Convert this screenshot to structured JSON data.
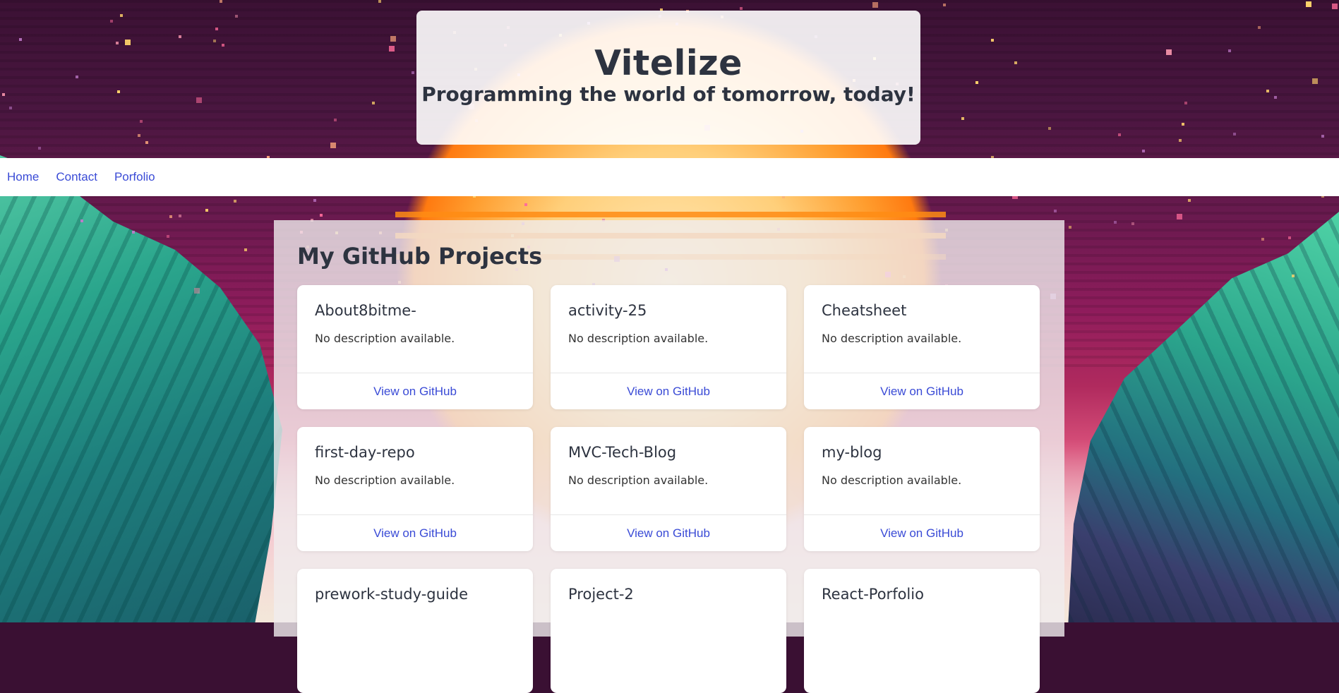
{
  "header": {
    "title": "Vitelize",
    "tagline": "Programming the world of tomorrow, today!"
  },
  "nav": {
    "items": [
      {
        "label": "Home"
      },
      {
        "label": "Contact"
      },
      {
        "label": "Porfolio"
      }
    ]
  },
  "projects": {
    "heading": "My GitHub Projects",
    "link_label": "View on GitHub",
    "items": [
      {
        "name": "About8bitme-",
        "description": "No description available."
      },
      {
        "name": "activity-25",
        "description": "No description available."
      },
      {
        "name": "Cheatsheet",
        "description": "No description available."
      },
      {
        "name": "first-day-repo",
        "description": "No description available."
      },
      {
        "name": "MVC-Tech-Blog",
        "description": "No description available."
      },
      {
        "name": "my-blog",
        "description": "No description available."
      },
      {
        "name": "prework-study-guide",
        "description": ""
      },
      {
        "name": "Project-2",
        "description": ""
      },
      {
        "name": "React-Porfolio",
        "description": ""
      }
    ]
  },
  "colors": {
    "link": "#3a4bd6",
    "heading_text": "#2d3340"
  }
}
